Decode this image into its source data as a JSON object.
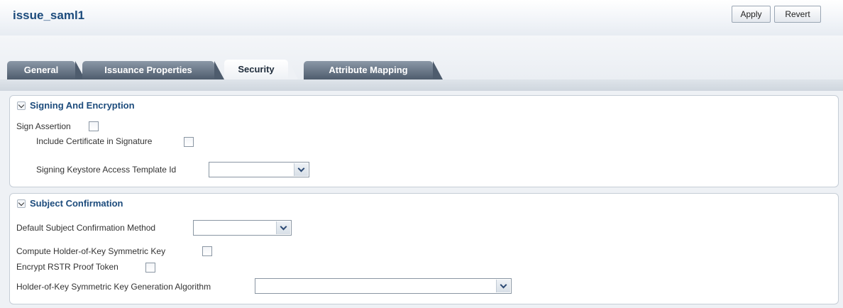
{
  "page": {
    "title": "issue_saml1"
  },
  "toolbar": {
    "apply_label": "Apply",
    "revert_label": "Revert"
  },
  "tabs": [
    {
      "label": "General",
      "active": false
    },
    {
      "label": "Issuance Properties",
      "active": false
    },
    {
      "label": "Security",
      "active": true
    },
    {
      "label": "Attribute Mapping",
      "active": false
    }
  ],
  "signing": {
    "title": "Signing And Encryption",
    "sign_assertion": {
      "label": "Sign Assertion",
      "checked": false
    },
    "include_cert": {
      "label": "Include Certificate in Signature",
      "checked": false
    },
    "keystore_template": {
      "label": "Signing Keystore Access Template Id",
      "value": ""
    }
  },
  "subject": {
    "title": "Subject Confirmation",
    "default_method": {
      "label": "Default Subject Confirmation Method",
      "value": ""
    },
    "compute_hok": {
      "label": "Compute Holder-of-Key Symmetric Key",
      "checked": false
    },
    "encrypt_rstr": {
      "label": "Encrypt RSTR Proof Token",
      "checked": false
    },
    "hok_algorithm": {
      "label": "Holder-of-Key Symmetric Key Generation Algorithm",
      "value": ""
    }
  },
  "colors": {
    "title": "#1c4b7c",
    "tab_inactive": "#4e5c6d",
    "accent": "#2c4a74"
  }
}
